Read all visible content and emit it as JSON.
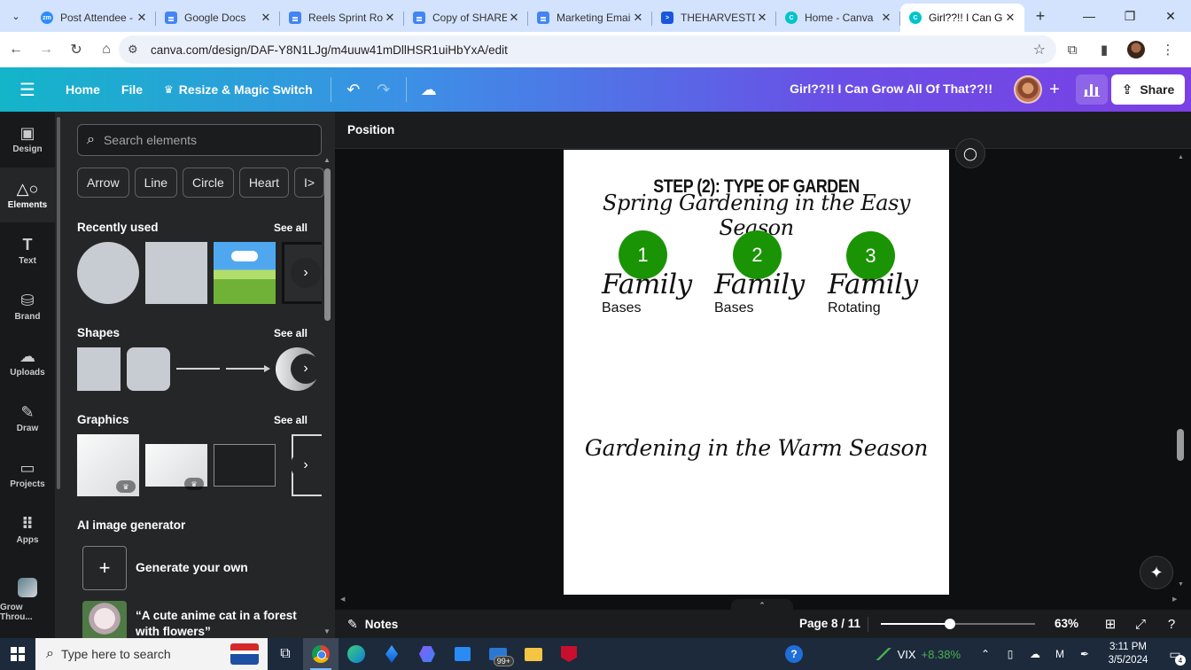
{
  "browser": {
    "tabs": [
      {
        "title": "Post Attendee - Zoom",
        "favicon": "zoom-icon"
      },
      {
        "title": "Google Docs",
        "favicon": "google-docs-icon"
      },
      {
        "title": "Reels Sprint Round",
        "favicon": "google-docs-icon"
      },
      {
        "title": "Copy of SHARE:",
        "favicon": "google-docs-icon"
      },
      {
        "title": "Marketing Email",
        "favicon": "google-docs-icon"
      },
      {
        "title": "THEHARVESTDOC",
        "favicon": "harvest-icon"
      },
      {
        "title": "Home - Canva",
        "favicon": "canva-icon"
      },
      {
        "title": "Girl??!! I Can Grow",
        "favicon": "canva-icon",
        "active": true
      }
    ],
    "close_glyph": "✕",
    "new_tab_glyph": "+",
    "url": "canva.com/design/DAF-Y8N1LJg/m4uuw41mDllHSR1uiHbYxA/edit"
  },
  "canva_header": {
    "home": "Home",
    "file": "File",
    "resize": "Resize & Magic Switch",
    "design_title": "Girl??!! I Can Grow All Of That??!!",
    "share": "Share",
    "gradient_colors": [
      "#13b5c9",
      "#3d8fe6",
      "#7b3fe4"
    ]
  },
  "rail": {
    "items": [
      {
        "label": "Design",
        "icon": "layout-icon"
      },
      {
        "label": "Elements",
        "icon": "elements-icon",
        "active": true
      },
      {
        "label": "Text",
        "icon": "text-icon"
      },
      {
        "label": "Brand",
        "icon": "brand-icon"
      },
      {
        "label": "Uploads",
        "icon": "cloud-upload-icon"
      },
      {
        "label": "Draw",
        "icon": "draw-icon"
      },
      {
        "label": "Projects",
        "icon": "folder-icon"
      },
      {
        "label": "Apps",
        "icon": "apps-grid-icon"
      },
      {
        "label": "Grow Throu...",
        "icon": "project-thumbnail"
      }
    ]
  },
  "panel": {
    "search_placeholder": "Search elements",
    "chips": [
      "Arrow",
      "Line",
      "Circle",
      "Heart",
      "I>"
    ],
    "recently_used": {
      "title": "Recently used",
      "see_all": "See all"
    },
    "shapes": {
      "title": "Shapes",
      "see_all": "See all"
    },
    "graphics": {
      "title": "Graphics",
      "see_all": "See all"
    },
    "ai": {
      "title": "AI image generator",
      "generate_label": "Generate your own",
      "example_prompt": "“A cute anime cat in a forest with flowers”"
    }
  },
  "editor": {
    "position_label": "Position",
    "notes_label": "Notes",
    "page_indicator": "Page 8 / 11",
    "zoom_label": "63%",
    "zoom_fraction": 0.45,
    "design": {
      "step_heading": "STEP (2): TYPE OF GARDEN",
      "spring_line": "Spring Gardening in the Easy Season",
      "steps": [
        {
          "number": "1",
          "family": "Family",
          "sub": "Bases"
        },
        {
          "number": "2",
          "family": "Family",
          "sub": "Bases"
        },
        {
          "number": "3",
          "family": "Family",
          "sub": "Rotating"
        }
      ],
      "warm_line": "Gardening in the Warm Season",
      "circle_color": "#1a9405"
    }
  },
  "taskbar": {
    "search_placeholder": "Type here to search",
    "mail_badge": "99+",
    "stock_name": "VIX",
    "stock_change": "+8.38%",
    "time": "3:11 PM",
    "date": "3/5/2024",
    "notification_count": "4"
  }
}
